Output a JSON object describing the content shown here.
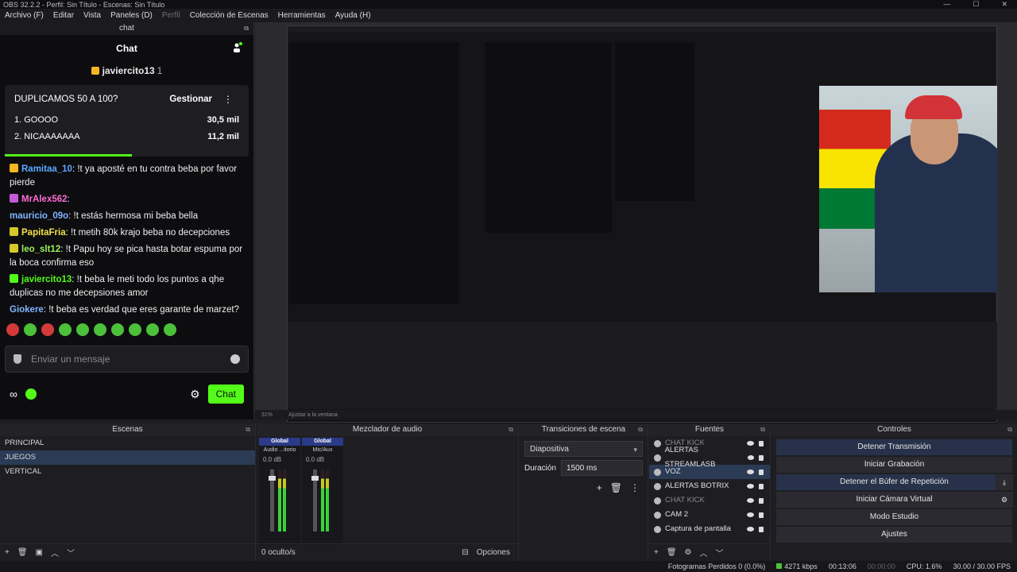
{
  "window": {
    "title": "OBS 32.2.2 - Perfil: Sin Título - Escenas: Sin Título"
  },
  "menu": [
    "Archivo (F)",
    "Editar",
    "Vista",
    "Paneles (D)",
    "Perfil",
    "Colección de Escenas",
    "Herramientas",
    "Ayuda (H)"
  ],
  "chat": {
    "dock_title": "chat",
    "header": "Chat",
    "host": {
      "name": "javiercito13",
      "count": "1"
    },
    "poll": {
      "question": "DUPLICAMOS 50 A 100?",
      "manage_label": "Gestionar",
      "options": [
        {
          "label": "1. GOOOO",
          "votes": "30,5 mil"
        },
        {
          "label": "2. NICAAAAAAA",
          "votes": "11,2 mil"
        }
      ],
      "progress_fraction": 0.52
    },
    "messages": [
      {
        "user": "Ramitaa_10",
        "color": "#5aa7ff",
        "badge": "#f5b622",
        "text": ": !t ya aposté en tu contra beba por favor pierde"
      },
      {
        "user": "MrAlex562",
        "color": "#ff6bd6",
        "badge": "#c45bd6",
        "text": ":"
      },
      {
        "user": "mauricio_09o",
        "color": "#7fb4ff",
        "badge": "",
        "text": ": !t estás hermosa mi beba bella"
      },
      {
        "user": "PapitaFria",
        "color": "#f5e04a",
        "badge": "#d6c82a",
        "text": ": !t metih 80k krajo beba no decepciones"
      },
      {
        "user": "leo_slt12",
        "color": "#9af05a",
        "badge": "#d6c82a",
        "text": ": !t Papu hoy se pica hasta botar espuma por la boca confirma eso"
      },
      {
        "user": "javiercito13",
        "color": "#53fc18",
        "badge": "#53fc18",
        "text": ": !t beba le meti todo los puntos a qhe duplicas no me decepsiones amor"
      },
      {
        "user": "Giokere",
        "color": "#7fb4ff",
        "badge": "",
        "text": ": !t beba es verdad que eres garante de marzet?"
      }
    ],
    "input_placeholder": "Enviar un mensaje",
    "send_label": "Chat"
  },
  "preview": {
    "zoom": "31%",
    "fit_label": "Ajustar a la ventana"
  },
  "scenes": {
    "title": "Escenas",
    "items": [
      "PRINCIPAL",
      "JUEGOS",
      "VERTICAL"
    ],
    "selected": "JUEGOS"
  },
  "mixer": {
    "title": "Mezclador de audio",
    "channels": [
      {
        "name": "Global",
        "sub": "Audio ...itorio",
        "db": "0.0 dB"
      },
      {
        "name": "Global",
        "sub": "Mic/Aux",
        "db": "0.0 dB"
      }
    ],
    "hidden": "0 oculto/s",
    "options": "Opciones"
  },
  "transitions": {
    "title": "Transiciones de escena",
    "type": "Diapositiva",
    "duration_label": "Duración",
    "duration_value": "1500 ms"
  },
  "sources": {
    "title": "Fuentes",
    "items": [
      {
        "name": "CHAT KICK",
        "dim": true
      },
      {
        "name": "ALERTAS STREAMLASB",
        "dim": false
      },
      {
        "name": "VOZ",
        "dim": false
      },
      {
        "name": "ALERTAS BOTRIX",
        "dim": false
      },
      {
        "name": "CHAT KICK",
        "dim": true
      },
      {
        "name": "CAM 2",
        "dim": false
      },
      {
        "name": "Captura de pantalla",
        "dim": false
      }
    ]
  },
  "controls": {
    "title": "Controles",
    "buttons": [
      {
        "label": "Detener Transmisión",
        "active": true
      },
      {
        "label": "Iniciar Grabación",
        "active": false
      },
      {
        "label": "Detener el Búfer de Repetición",
        "active": true
      },
      {
        "label": "Iniciar Cámara Virtual",
        "active": false
      },
      {
        "label": "Modo Estudio",
        "active": false
      },
      {
        "label": "Ajustes",
        "active": false
      }
    ]
  },
  "status": {
    "dropped": "Fotogramas Perdidos 0 (0.0%)",
    "bitrate": "4271 kbps",
    "stream_time": "00:13:06",
    "rec_time": "00:00:00",
    "cpu": "CPU: 1.6%",
    "fps": "30.00 / 30.00 FPS"
  },
  "colors": {
    "kick_green": "#53fc18",
    "selection": "#2b3b55"
  }
}
